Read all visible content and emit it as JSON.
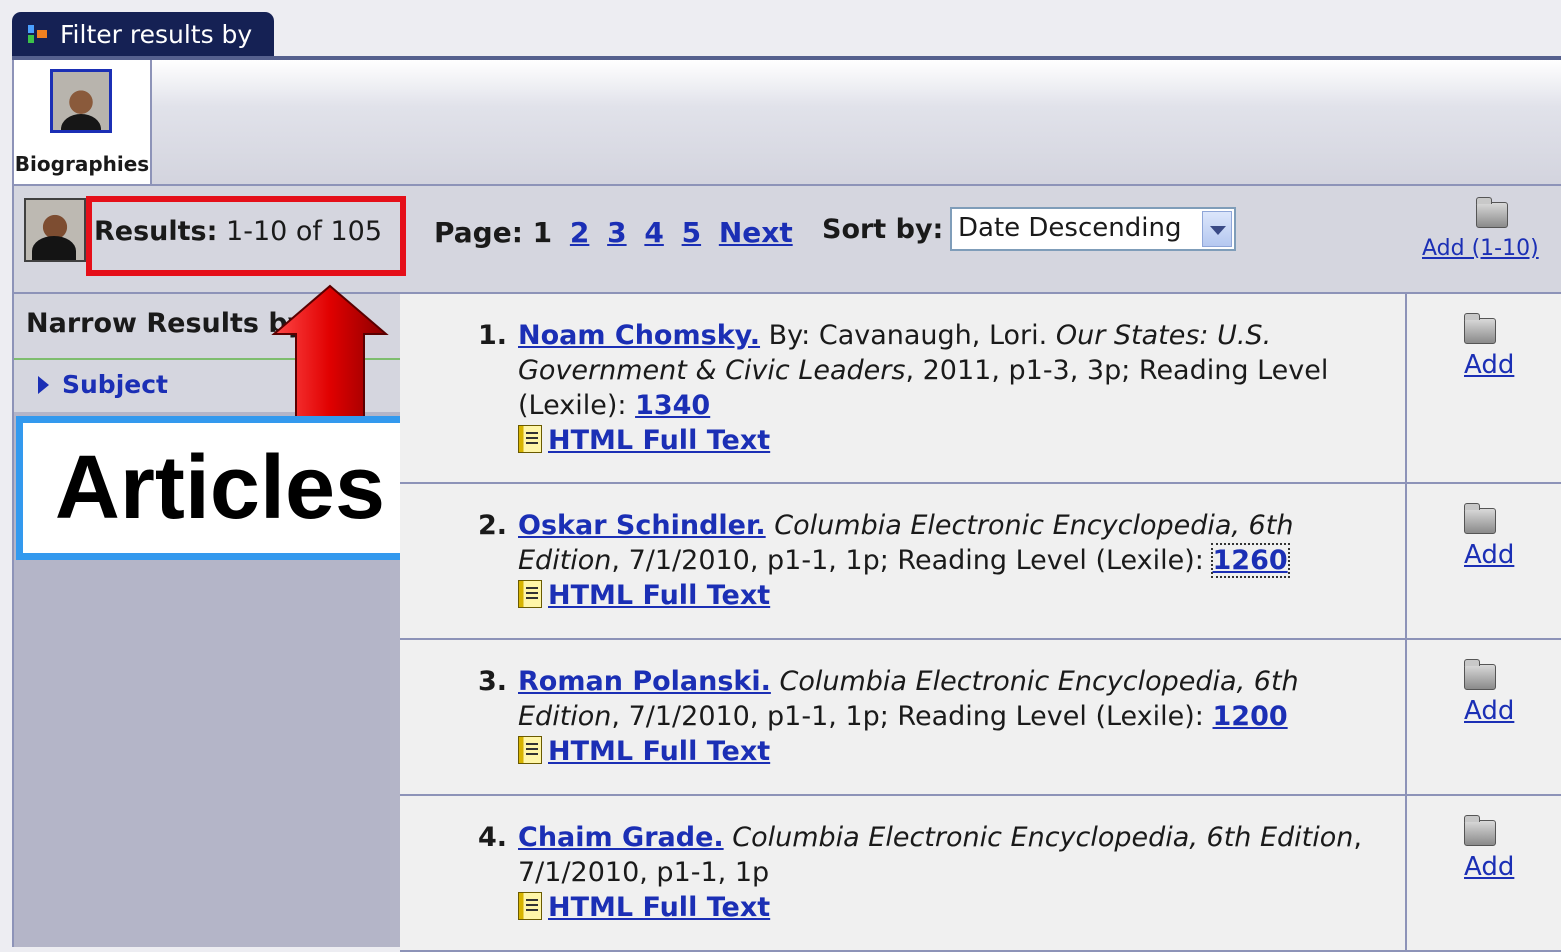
{
  "filter": {
    "title": "Filter results by",
    "source_label": "Biographies"
  },
  "results": {
    "label": "Results:",
    "range": "1-10 of 105",
    "page_label": "Page:",
    "current_page": "1",
    "pages": [
      "2",
      "3",
      "4",
      "5"
    ],
    "next_label": "Next",
    "sort_label": "Sort by:",
    "sort_value": "Date Descending",
    "add_all_label": "Add (1-10)"
  },
  "sidebar": {
    "narrow_title": "Narrow Results by",
    "subject_label": "Subject"
  },
  "callout": {
    "text": "Articles"
  },
  "items": [
    {
      "num": "1.",
      "title": "Noam Chomsky.",
      "byline": "By: Cavanaugh, Lori.",
      "source": "Our States: U.S. Government & Civic Leaders",
      "details": ", 2011, p1-3, 3p; Reading Level (Lexile):",
      "lexile": "1340",
      "fulltext": "HTML Full Text",
      "add": "Add"
    },
    {
      "num": "2.",
      "title": "Oskar Schindler.",
      "byline": "",
      "source": "Columbia Electronic Encyclopedia, 6th Edition",
      "details": ", 7/1/2010, p1-1, 1p; Reading Level (Lexile):",
      "lexile": "1260",
      "fulltext": "HTML Full Text",
      "add": "Add"
    },
    {
      "num": "3.",
      "title": "Roman Polanski.",
      "byline": "",
      "source": "Columbia Electronic Encyclopedia, 6th Edition",
      "details": ", 7/1/2010, p1-1, 1p; Reading Level (Lexile):",
      "lexile": "1200",
      "fulltext": "HTML Full Text",
      "add": "Add"
    },
    {
      "num": "4.",
      "title": "Chaim Grade.",
      "byline": "",
      "source": "Columbia Electronic Encyclopedia, 6th Edition",
      "details": ", 7/1/2010, p1-1, 1p",
      "fulltext": "HTML Full Text",
      "add": "Add"
    }
  ],
  "colors": {
    "tab": "#152154",
    "link": "#1b2fb5",
    "highlight_red": "#e50f19",
    "callout_blue": "#3399ee"
  }
}
